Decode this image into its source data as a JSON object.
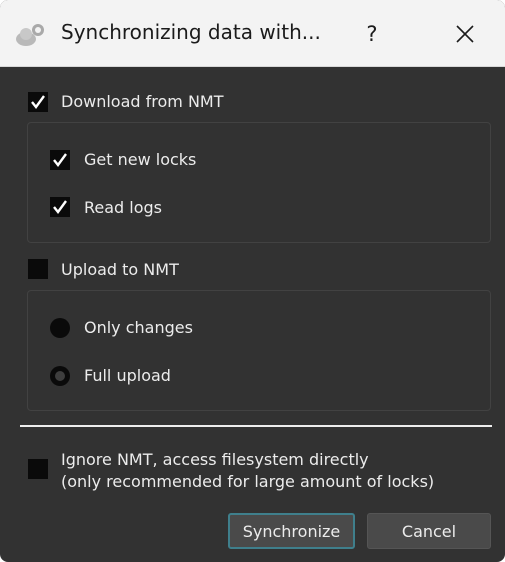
{
  "window": {
    "title": "Synchronizing data with...",
    "help_glyph": "?",
    "close_icon": "close-icon",
    "app_icon": "cloud-sync-icon"
  },
  "download": {
    "label": "Download from NMT",
    "checked": true,
    "options": [
      {
        "label": "Get new locks",
        "checked": true
      },
      {
        "label": "Read logs",
        "checked": true
      }
    ]
  },
  "upload": {
    "label": "Upload to NMT",
    "checked": false,
    "options": [
      {
        "label": "Only changes",
        "selected": false
      },
      {
        "label": "Full upload",
        "selected": true
      }
    ]
  },
  "ignore": {
    "line1": "Ignore NMT, access filesystem directly",
    "line2": "(only recommended for large amount of locks)",
    "checked": false
  },
  "buttons": {
    "synchronize": "Synchronize",
    "cancel": "Cancel"
  },
  "colors": {
    "background": "#323232",
    "titlebar": "#f3f3f3",
    "focus_border": "#3f7f8c"
  }
}
